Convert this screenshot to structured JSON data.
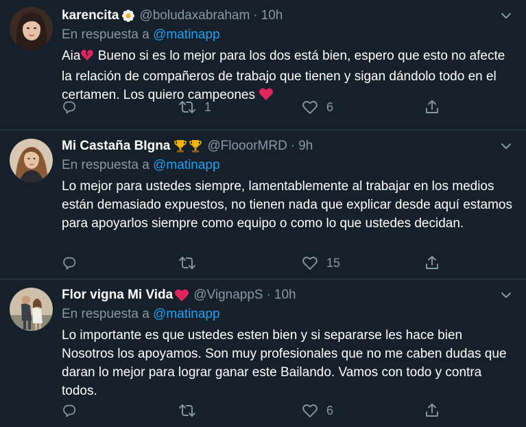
{
  "tweets": [
    {
      "display_name": "karencita",
      "handle": "@boludaxabraham",
      "dot": "·",
      "time": "10h",
      "reply_prefix": "En respuesta a",
      "reply_mention": "@matinapp",
      "text_parts": [
        "Aia",
        " Bueno si es lo mejor para los dos está bien, espero que esto no afecte la relación de compañeros de trabajo que tienen y sigan dándolo todo en el certamen. Los quiero campeones "
      ],
      "reply_count": "",
      "retweet_count": "1",
      "like_count": "6"
    },
    {
      "display_name": "Mi Castaña BIgna",
      "handle": "@FlooorMRD",
      "dot": "·",
      "time": "9h",
      "reply_prefix": "En respuesta a",
      "reply_mention": "@matinapp",
      "text": "Lo mejor para ustedes siempre, lamentablemente al trabajar en los medios están demasiado expuestos, no tienen nada que explicar desde aquí estamos para apoyarlos siempre como equipo o como lo que ustedes decidan.",
      "reply_count": "",
      "retweet_count": "",
      "like_count": "15"
    },
    {
      "display_name": "Flor vigna Mi Vida",
      "handle": "@VignappS",
      "dot": "·",
      "time": "10h",
      "reply_prefix": "En respuesta a",
      "reply_mention": "@matinapp",
      "text": "Lo importante es que ustedes esten bien y si separarse les hace bien Nosotros los apoyamos. Son muy profesionales que no me caben dudas que daran lo mejor para lograr ganar este Bailando. Vamos con todo y contra todos.",
      "reply_count": "",
      "retweet_count": "",
      "like_count": "6"
    }
  ],
  "colors": {
    "background": "#15202b",
    "divider": "#38444d",
    "secondary_text": "#8899a6",
    "mention": "#1da1f2",
    "heart_red": "#e0245e"
  },
  "icons": {
    "reply": "reply-icon",
    "retweet": "retweet-icon",
    "like": "heart-icon",
    "share": "share-icon",
    "caret": "chevron-down-icon"
  }
}
